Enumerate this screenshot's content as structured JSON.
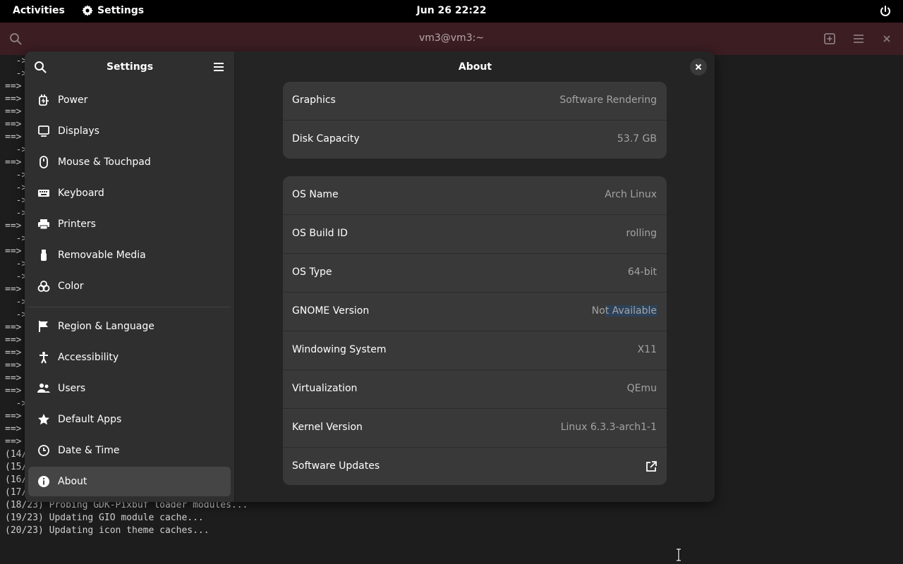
{
  "topbar": {
    "activities": "Activities",
    "app_name": "Settings",
    "clock": "Jun 26  22:22"
  },
  "terminal": {
    "title": "vm3@vm3:~",
    "lines": [
      "  ->",
      "  ->",
      "==>",
      "==>",
      "==>",
      "==>",
      "==>",
      "  ->",
      "==>",
      "  ->",
      "  ->",
      "  ->",
      "  ->",
      "==>",
      "  ->",
      "==>",
      "  ->",
      "  ->",
      "==>",
      "  ->",
      "  ->",
      "==>",
      "==>",
      "==>",
      "==>",
      "==>",
      "==>",
      "  ->",
      "==>",
      "==>",
      "==>",
      "(14/",
      "(15/",
      "(16/",
      "(17/",
      "(18/23) Probing GDK-Pixbuf loader modules...",
      "(19/23) Updating GIO module cache...",
      "(20/23) Updating icon theme caches..."
    ]
  },
  "settings": {
    "sidebar_title": "Settings",
    "sidebar_items": [
      {
        "label": "Power",
        "icon": "power-plug-icon"
      },
      {
        "label": "Displays",
        "icon": "display-icon"
      },
      {
        "label": "Mouse & Touchpad",
        "icon": "mouse-icon"
      },
      {
        "label": "Keyboard",
        "icon": "keyboard-icon"
      },
      {
        "label": "Printers",
        "icon": "printer-icon"
      },
      {
        "label": "Removable Media",
        "icon": "usb-icon"
      },
      {
        "label": "Color",
        "icon": "color-icon"
      },
      {
        "label": "Region & Language",
        "icon": "flag-icon"
      },
      {
        "label": "Accessibility",
        "icon": "accessibility-icon"
      },
      {
        "label": "Users",
        "icon": "users-icon"
      },
      {
        "label": "Default Apps",
        "icon": "star-icon"
      },
      {
        "label": "Date & Time",
        "icon": "clock-icon"
      },
      {
        "label": "About",
        "icon": "info-icon",
        "active": true
      }
    ],
    "content_title": "About",
    "card1": [
      {
        "label": "Graphics",
        "value": "Software Rendering"
      },
      {
        "label": "Disk Capacity",
        "value": "53.7 GB"
      }
    ],
    "card2": [
      {
        "label": "OS Name",
        "value": "Arch Linux"
      },
      {
        "label": "OS Build ID",
        "value": "rolling"
      },
      {
        "label": "OS Type",
        "value": "64-bit"
      },
      {
        "label": "GNOME Version",
        "value_unselected": "No",
        "value_selected": "t Available"
      },
      {
        "label": "Windowing System",
        "value": "X11"
      },
      {
        "label": "Virtualization",
        "value": "QEmu"
      },
      {
        "label": "Kernel Version",
        "value": "Linux 6.3.3-arch1-1"
      },
      {
        "label": "Software Updates",
        "icon": "external-link-icon"
      }
    ]
  },
  "colors": {
    "selection": "#2d425a",
    "terminal_header": "#3b1d22"
  }
}
